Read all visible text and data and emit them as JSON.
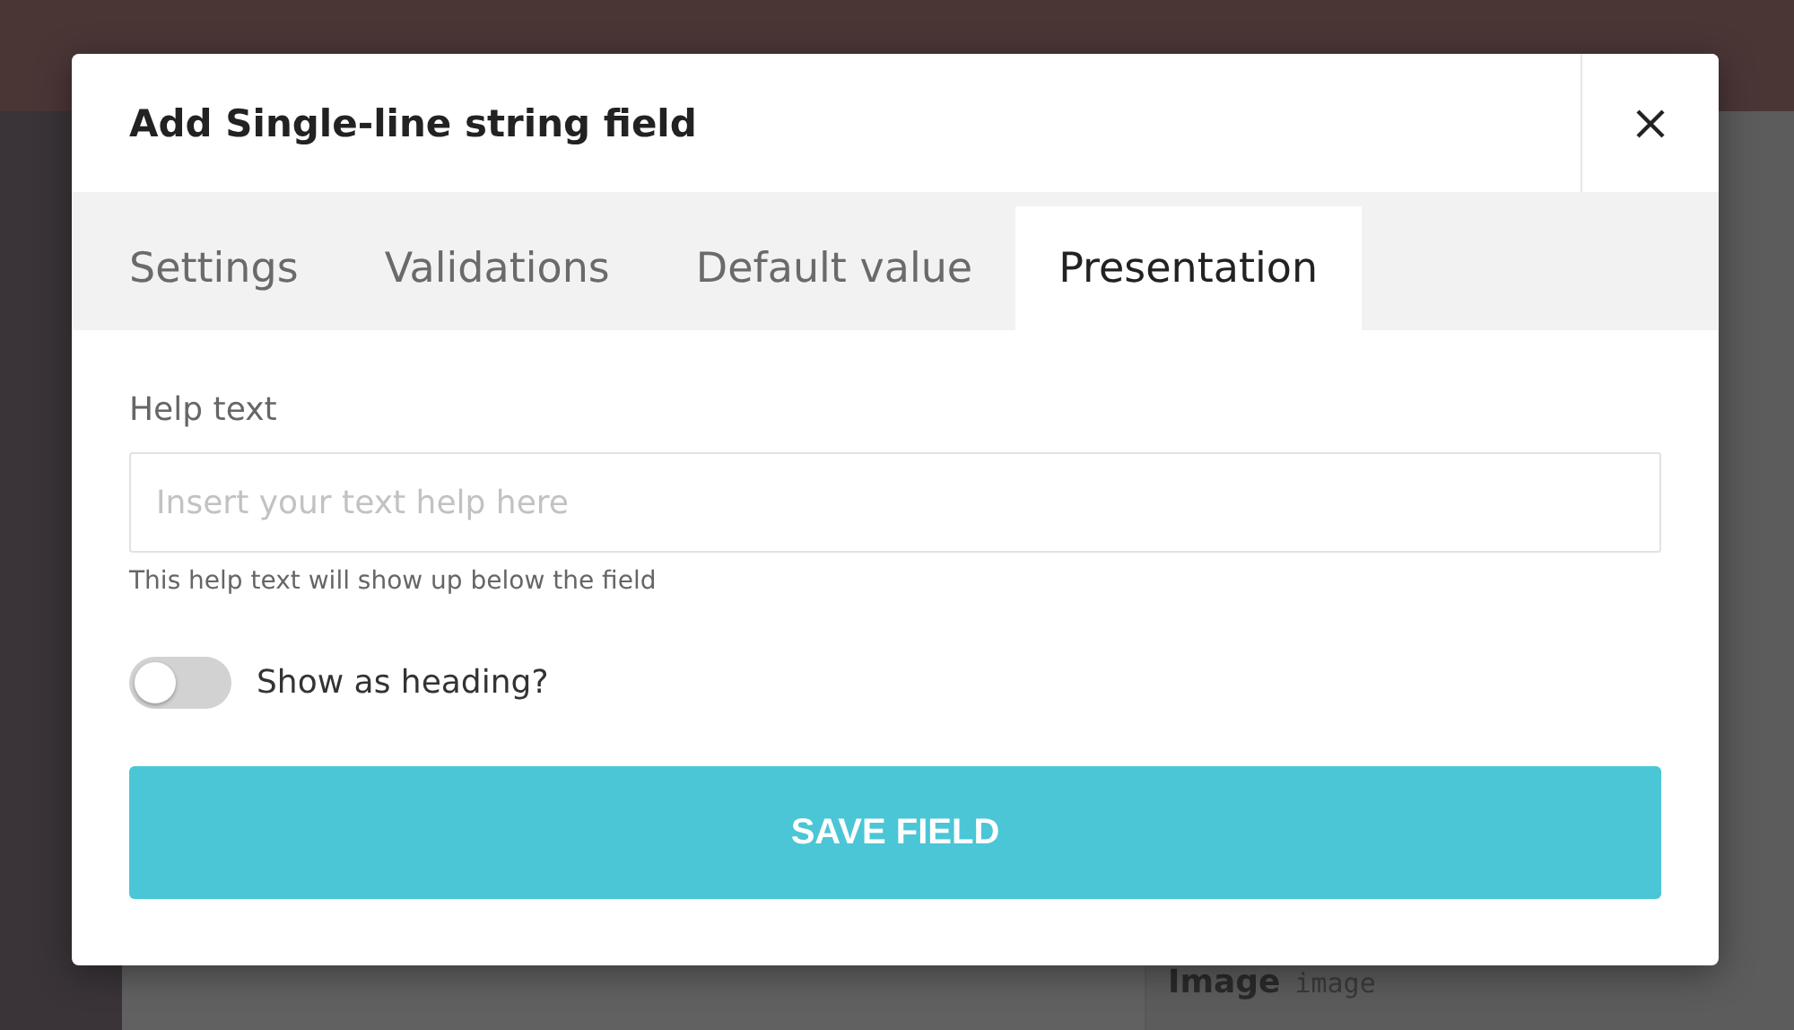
{
  "right_panel": {
    "field_name": "Image",
    "field_type": "image"
  },
  "dialog": {
    "title": "Add Single-line string field",
    "tabs": [
      {
        "label": "Settings",
        "selected": false
      },
      {
        "label": "Validations",
        "selected": false
      },
      {
        "label": "Default value",
        "selected": false
      },
      {
        "label": "Presentation",
        "selected": true
      }
    ],
    "help_field": {
      "label": "Help text",
      "placeholder": "Insert your text help here",
      "hint": "This help text will show up below the field"
    },
    "heading_toggle": {
      "label": "Show as heading?",
      "on": false
    },
    "save_button": "SAVE FIELD"
  }
}
